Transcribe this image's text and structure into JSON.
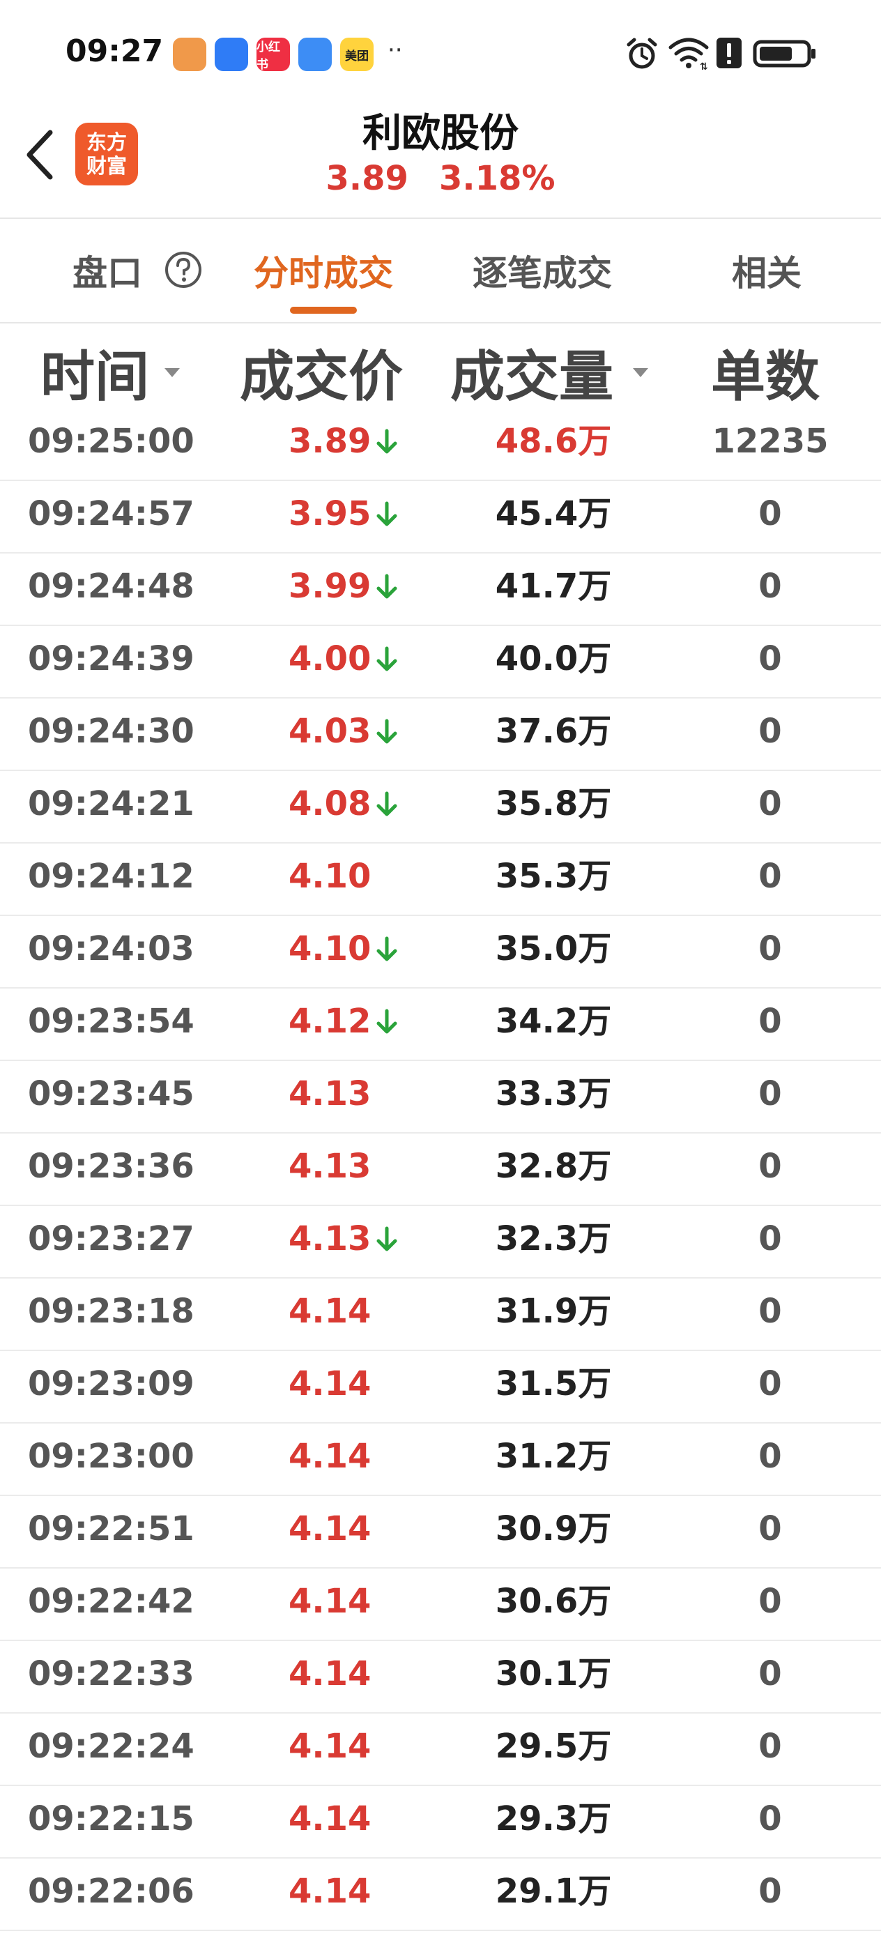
{
  "status_bar": {
    "time": "09:27",
    "apps": [
      {
        "name": "heart-app-icon",
        "label": "",
        "color": "#f0994a"
      },
      {
        "name": "avatar-app-icon",
        "label": "",
        "color": "#2f7cf6"
      },
      {
        "name": "xiaohongshu-app-icon",
        "label": "小红书",
        "color": "#ef2f43"
      },
      {
        "name": "clover-app-icon",
        "label": "",
        "color": "#3d8df5"
      },
      {
        "name": "meituan-app-icon",
        "label": "美团",
        "color": "#ffd33d"
      }
    ],
    "more": "··",
    "battery_level": 0.72
  },
  "header": {
    "logo_line1": "东方",
    "logo_line2": "财富",
    "stock_name": "利欧股份",
    "price": "3.89",
    "change_pct": "3.18%"
  },
  "tabs": [
    {
      "label": "盘口",
      "active": false
    },
    {
      "label": "分时成交",
      "active": true
    },
    {
      "label": "逐笔成交",
      "active": false
    },
    {
      "label": "相关",
      "active": false
    }
  ],
  "columns": {
    "time": "时间",
    "price": "成交价",
    "volume": "成交量",
    "count": "单数"
  },
  "colors": {
    "up_red": "#d93a33",
    "down_green": "#2aa33a",
    "accent_orange": "#e0661f"
  },
  "rows": [
    {
      "time": "09:25:00",
      "price": "3.89",
      "down": true,
      "volume": "48.6万",
      "count": "12235",
      "vol_red": true
    },
    {
      "time": "09:24:57",
      "price": "3.95",
      "down": true,
      "volume": "45.4万",
      "count": "0"
    },
    {
      "time": "09:24:48",
      "price": "3.99",
      "down": true,
      "volume": "41.7万",
      "count": "0"
    },
    {
      "time": "09:24:39",
      "price": "4.00",
      "down": true,
      "volume": "40.0万",
      "count": "0"
    },
    {
      "time": "09:24:30",
      "price": "4.03",
      "down": true,
      "volume": "37.6万",
      "count": "0"
    },
    {
      "time": "09:24:21",
      "price": "4.08",
      "down": true,
      "volume": "35.8万",
      "count": "0"
    },
    {
      "time": "09:24:12",
      "price": "4.10",
      "down": false,
      "volume": "35.3万",
      "count": "0"
    },
    {
      "time": "09:24:03",
      "price": "4.10",
      "down": true,
      "volume": "35.0万",
      "count": "0"
    },
    {
      "time": "09:23:54",
      "price": "4.12",
      "down": true,
      "volume": "34.2万",
      "count": "0"
    },
    {
      "time": "09:23:45",
      "price": "4.13",
      "down": false,
      "volume": "33.3万",
      "count": "0"
    },
    {
      "time": "09:23:36",
      "price": "4.13",
      "down": false,
      "volume": "32.8万",
      "count": "0"
    },
    {
      "time": "09:23:27",
      "price": "4.13",
      "down": true,
      "volume": "32.3万",
      "count": "0"
    },
    {
      "time": "09:23:18",
      "price": "4.14",
      "down": false,
      "volume": "31.9万",
      "count": "0"
    },
    {
      "time": "09:23:09",
      "price": "4.14",
      "down": false,
      "volume": "31.5万",
      "count": "0"
    },
    {
      "time": "09:23:00",
      "price": "4.14",
      "down": false,
      "volume": "31.2万",
      "count": "0"
    },
    {
      "time": "09:22:51",
      "price": "4.14",
      "down": false,
      "volume": "30.9万",
      "count": "0"
    },
    {
      "time": "09:22:42",
      "price": "4.14",
      "down": false,
      "volume": "30.6万",
      "count": "0"
    },
    {
      "time": "09:22:33",
      "price": "4.14",
      "down": false,
      "volume": "30.1万",
      "count": "0"
    },
    {
      "time": "09:22:24",
      "price": "4.14",
      "down": false,
      "volume": "29.5万",
      "count": "0"
    },
    {
      "time": "09:22:15",
      "price": "4.14",
      "down": false,
      "volume": "29.3万",
      "count": "0"
    },
    {
      "time": "09:22:06",
      "price": "4.14",
      "down": false,
      "volume": "29.1万",
      "count": "0"
    }
  ]
}
